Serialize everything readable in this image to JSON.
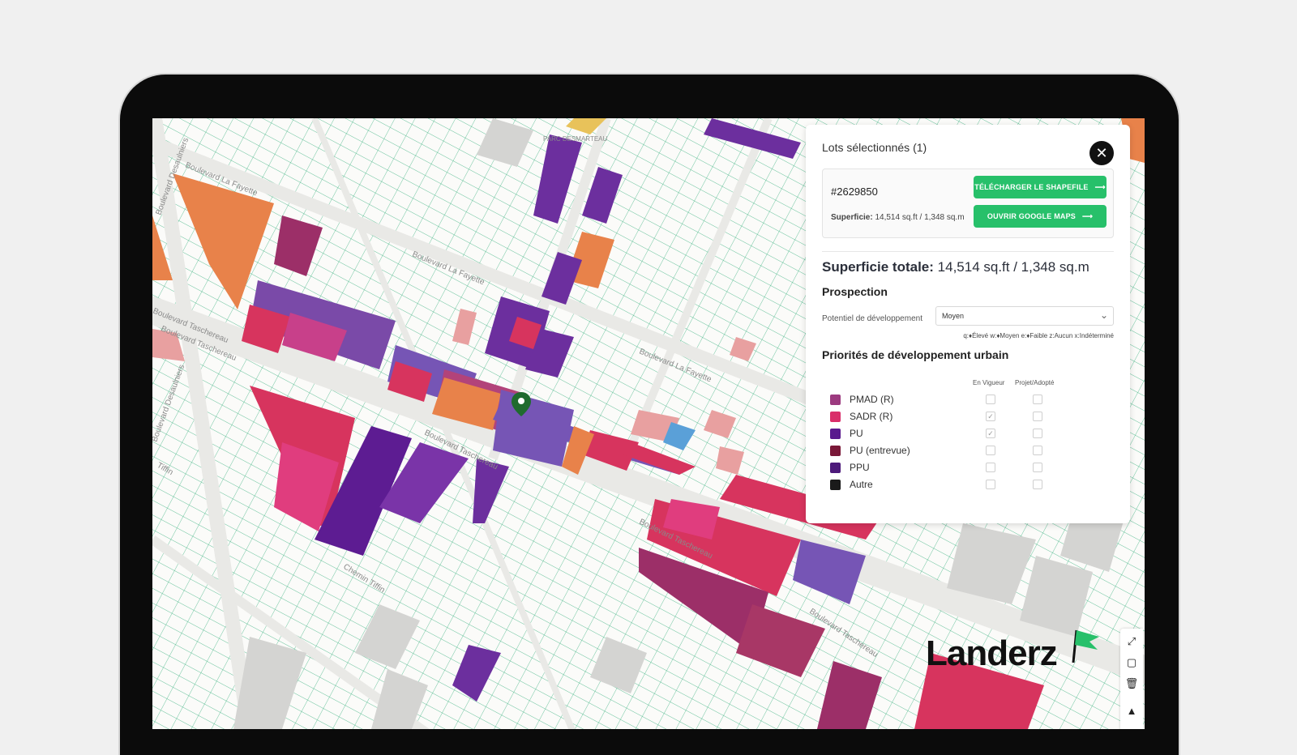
{
  "map": {
    "street_labels": [
      "Boulevard La Fayette",
      "Boulevard La Fayette",
      "Boulevard La Fayette",
      "Boulevard Taschereau",
      "Boulevard Taschereau",
      "Boulevard Taschereau",
      "Boulevard Taschereau",
      "Boulevard Taschereau",
      "Boulevard Desaulniers",
      "Boulevard Desaulniers",
      "Chemin Tiffin",
      "Tiffin",
      "PARC DESMARTEAU"
    ]
  },
  "panel": {
    "title": "Lots sélectionnés (1)",
    "close_symbol": "✕",
    "lot": {
      "id": "#2629850",
      "area_label": "Superficie:",
      "area_value": "14,514 sq.ft / 1,348 sq.m",
      "shapefile_button": "TÉLÉCHARGER LE SHAPEFILE",
      "gmaps_button": "OUVRIR GOOGLE MAPS",
      "arrow": "⟶"
    },
    "total_label": "Superficie totale:",
    "total_value": "14,514 sq.ft / 1,348 sq.m",
    "prospection_heading": "Prospection",
    "potential_label": "Potentiel de développement",
    "potential_value": "Moyen",
    "potential_legend": "q:♦Élevé  w:♦Moyen  e:♦Faible  z:Aucun  x:Indéterminé",
    "priorities_heading": "Priorités de développement urbain",
    "col_en_vigueur": "En Vigueur",
    "col_projet": "Projet/Adopté",
    "priorities": [
      {
        "label": "PMAD (R)",
        "color": "#9c3a7f",
        "en_vigueur": false,
        "projet": false
      },
      {
        "label": "SADR (R)",
        "color": "#d92e6a",
        "en_vigueur": true,
        "projet": false
      },
      {
        "label": "PU",
        "color": "#5a1a8e",
        "en_vigueur": true,
        "projet": false
      },
      {
        "label": "PU (entrevue)",
        "color": "#7a1838",
        "en_vigueur": false,
        "projet": false
      },
      {
        "label": "PPU",
        "color": "#4d1a7a",
        "en_vigueur": false,
        "projet": false
      },
      {
        "label": "Autre",
        "color": "#1a1a1a",
        "en_vigueur": false,
        "projet": false
      }
    ]
  },
  "brand": {
    "logo_text": "Landerz"
  },
  "toolbar": {
    "edit": "⤢",
    "square": "▢",
    "trash": "🗑",
    "compass": "▲"
  },
  "colors": {
    "accent_green": "#27c06a",
    "parcel_line": "#2fb57a",
    "orange": "#e88a4a"
  }
}
